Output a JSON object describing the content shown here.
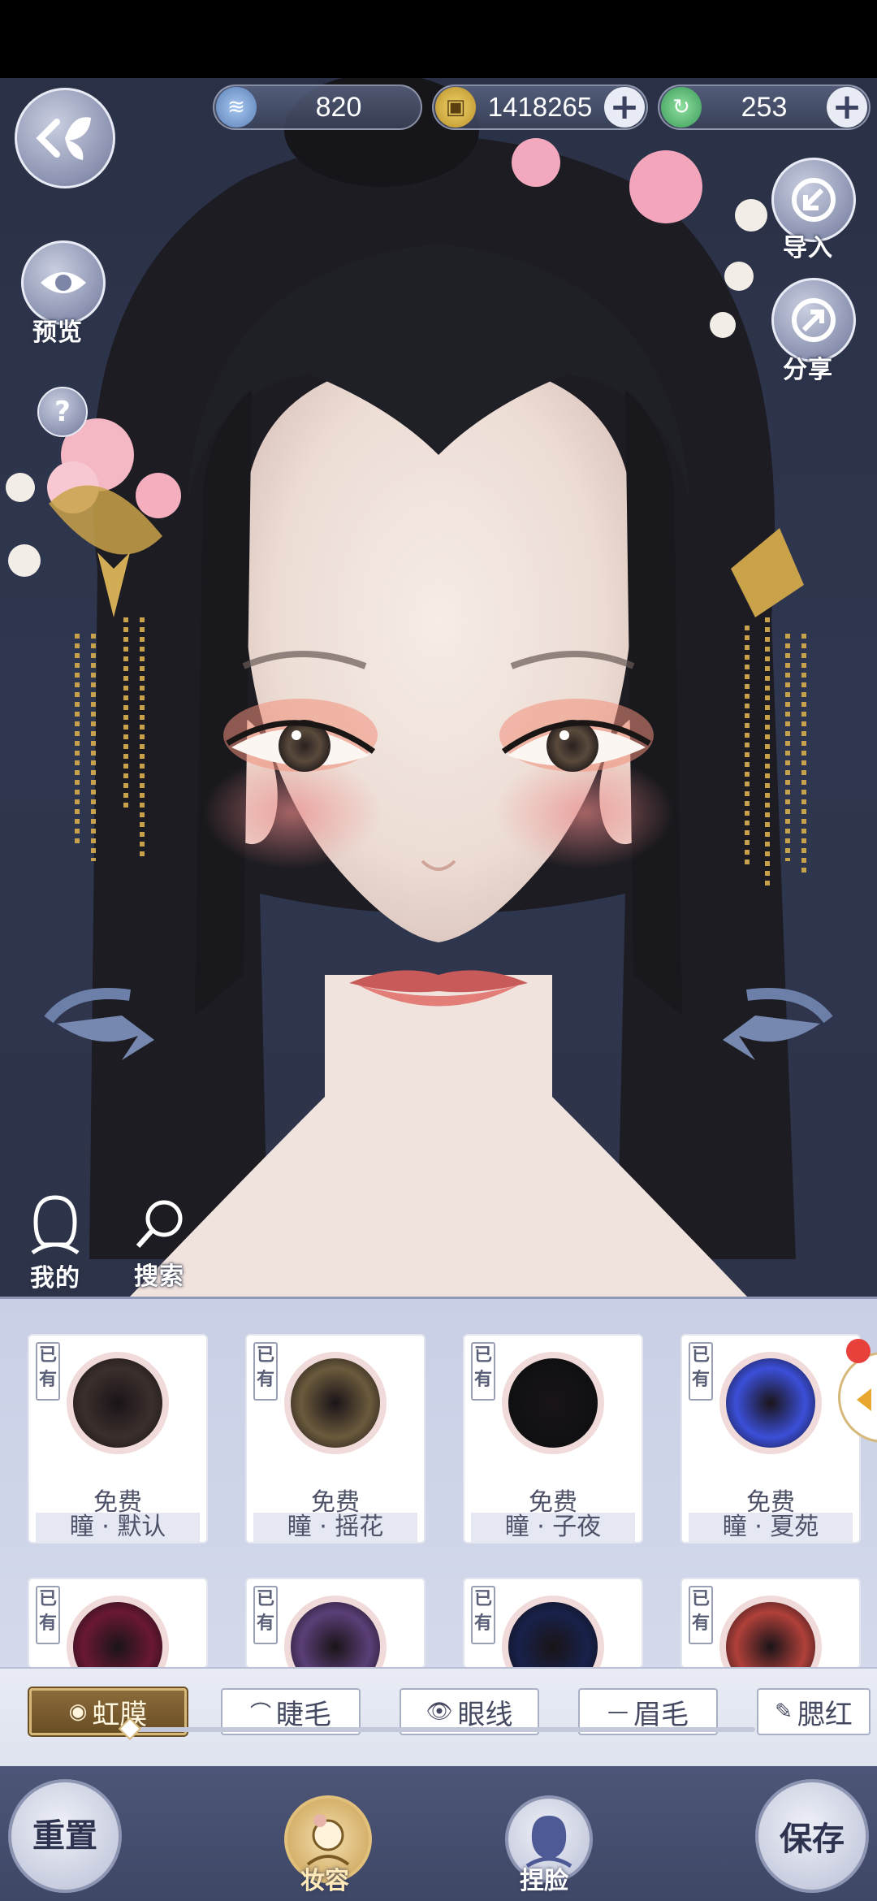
{
  "currency": {
    "jade": "820",
    "coins": "1418265",
    "tickets": "253"
  },
  "left_controls": {
    "preview_label": "预览",
    "help_label": "?"
  },
  "right_controls": {
    "import_label": "导入",
    "share_label": "分享"
  },
  "quick": {
    "mine_label": "我的",
    "search_label": "搜索"
  },
  "colors": {
    "panel_bg": "#d7dcec",
    "accent_gold": "#d6b97a",
    "nav_bg": "#3f4766"
  },
  "items": [
    {
      "owned": "已有",
      "price": "免费",
      "name": "瞳 · 默认",
      "iris_color": "#3b2f2c"
    },
    {
      "owned": "已有",
      "price": "免费",
      "name": "瞳 · 摇花",
      "iris_color": "#6b5a3c"
    },
    {
      "owned": "已有",
      "price": "免费",
      "name": "瞳 · 子夜",
      "iris_color": "#111114"
    },
    {
      "owned": "已有",
      "price": "免费",
      "name": "瞳 · 夏苑",
      "iris_color": "#3b4fd8"
    },
    {
      "owned": "已有",
      "iris_color": "#6a1834"
    },
    {
      "owned": "已有",
      "iris_color": "#5b3f78"
    },
    {
      "owned": "已有",
      "iris_color": "#18214a"
    },
    {
      "owned": "已有",
      "iris_color": "#b0403a"
    }
  ],
  "tabs": [
    {
      "label": "虹膜",
      "icon": "eye-circle-icon",
      "active": true
    },
    {
      "label": "睫毛",
      "icon": "eyelash-icon"
    },
    {
      "label": "眼线",
      "icon": "eyeliner-icon"
    },
    {
      "label": "眉毛",
      "icon": "eyebrow-icon"
    },
    {
      "label": "腮红",
      "icon": "blush-icon"
    }
  ],
  "bottom_nav": {
    "reset": "重置",
    "makeup": "妆容",
    "face": "捏脸",
    "save": "保存"
  }
}
